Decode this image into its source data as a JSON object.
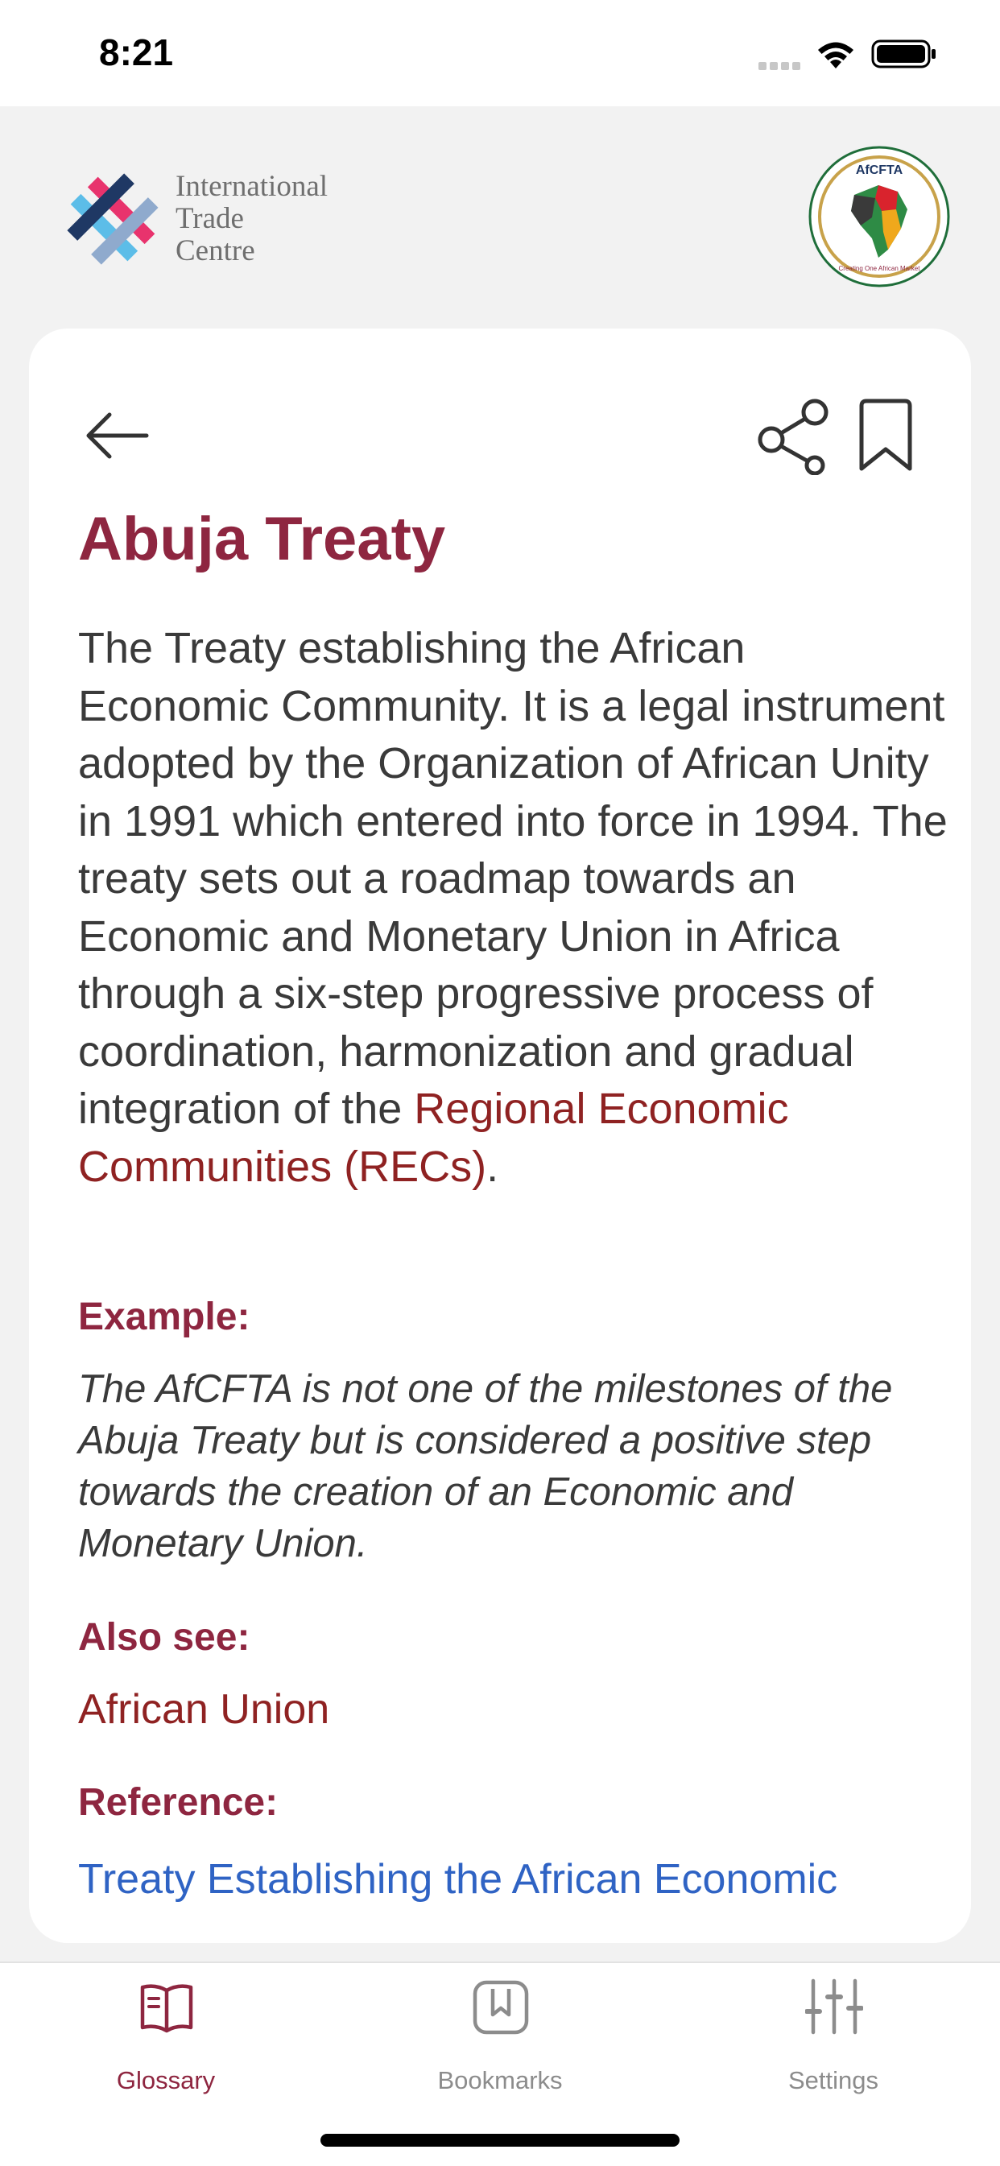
{
  "status_bar": {
    "time": "8:21",
    "icons": [
      "signal-icon",
      "wifi-icon",
      "battery-icon"
    ]
  },
  "header": {
    "itc_logo": {
      "lines": [
        "International",
        "Trade",
        "Centre"
      ],
      "colors": [
        "#e8336d",
        "#1f3864",
        "#5cbde8",
        "#8faacd"
      ]
    },
    "afcfta_logo": {
      "text": "AfCFTA",
      "motto": "Creating One African Market"
    }
  },
  "card": {
    "back_icon": "arrow-left-icon",
    "share_icon": "share-icon",
    "bookmark_icon": "bookmark-icon",
    "title": "Abuja Treaty",
    "definition": "The Treaty establishing the African Economic Community. It is a legal instrument adopted by the Organization of African Unity in 1991 which entered into force in 1994. The treaty sets out a roadmap towards an Economic and Monetary Union in Africa through a six-step progressive process of coordination, harmonization and gradual integration of the ",
    "definition_link": "Regional Economic Communities (RECs)",
    "definition_end": ".",
    "example_heading": "Example:",
    "example_text": "The AfCFTA is not one of the milestones of the Abuja Treaty but is considered a positive step towards the creation of an Economic and Monetary Union.",
    "also_see_heading": "Also see:",
    "also_see_link": "African Union",
    "reference_heading": "Reference:",
    "reference_link": "Treaty Establishing the African Economic Community"
  },
  "tab_bar": {
    "tabs": [
      {
        "label": "Glossary",
        "icon": "book-icon",
        "active": true
      },
      {
        "label": "Bookmarks",
        "icon": "bookmark-square-icon",
        "active": false
      },
      {
        "label": "Settings",
        "icon": "sliders-icon",
        "active": false
      }
    ],
    "colors": {
      "active": "#8e2640",
      "inactive": "#8c8c8c"
    }
  },
  "colors": {
    "accent": "#8e2640",
    "link_red": "#8f2222",
    "link_blue": "#2f63c4",
    "background": "#f2f2f2",
    "card": "#ffffff"
  }
}
